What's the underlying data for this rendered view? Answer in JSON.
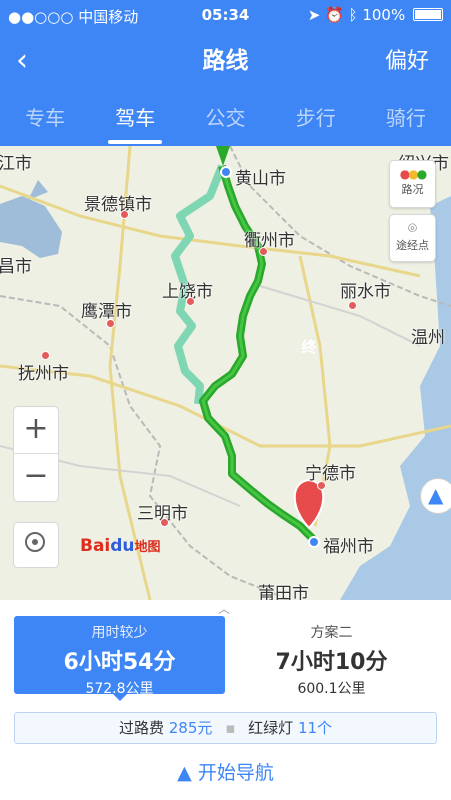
{
  "status": {
    "carrier": "●●○○○ 中国移动",
    "time": "05:34",
    "battery": "100%"
  },
  "nav": {
    "title": "路线",
    "pref": "偏好"
  },
  "tabs": [
    "专车",
    "驾车",
    "公交",
    "步行",
    "骑行"
  ],
  "map": {
    "cities": [
      "江市",
      "黄山市",
      "绍兴市",
      "景德镇市",
      "衢州市",
      "昌市",
      "上饶市",
      "丽水市",
      "鹰潭市",
      "温州",
      "抚州市",
      "宁德市",
      "三明市",
      "福州市",
      "莆田市"
    ],
    "end_marker": "终",
    "traffic_label": "路况",
    "waypoint_label": "途经点",
    "logo": "Bai地图",
    "logo_text": {
      "brand": "Bai",
      "paw": "du",
      "sub": "地图"
    },
    "zoom_in": "+",
    "zoom_out": "−"
  },
  "plans": [
    {
      "label": "用时较少",
      "time": "6小时54分",
      "distance": "572.8公里",
      "selected": true
    },
    {
      "label": "方案二",
      "time": "7小时10分",
      "distance": "600.1公里",
      "selected": false
    }
  ],
  "info": {
    "toll_label": "过路费",
    "toll_value": "285元",
    "lights_label": "红绿灯",
    "lights_value": "11个"
  },
  "start_nav": "开始导航",
  "colors": {
    "accent": "#3e86f5",
    "route_main": "#2aa82a",
    "route_alt": "#7fd6b3",
    "end_marker": "#e84b4b"
  }
}
